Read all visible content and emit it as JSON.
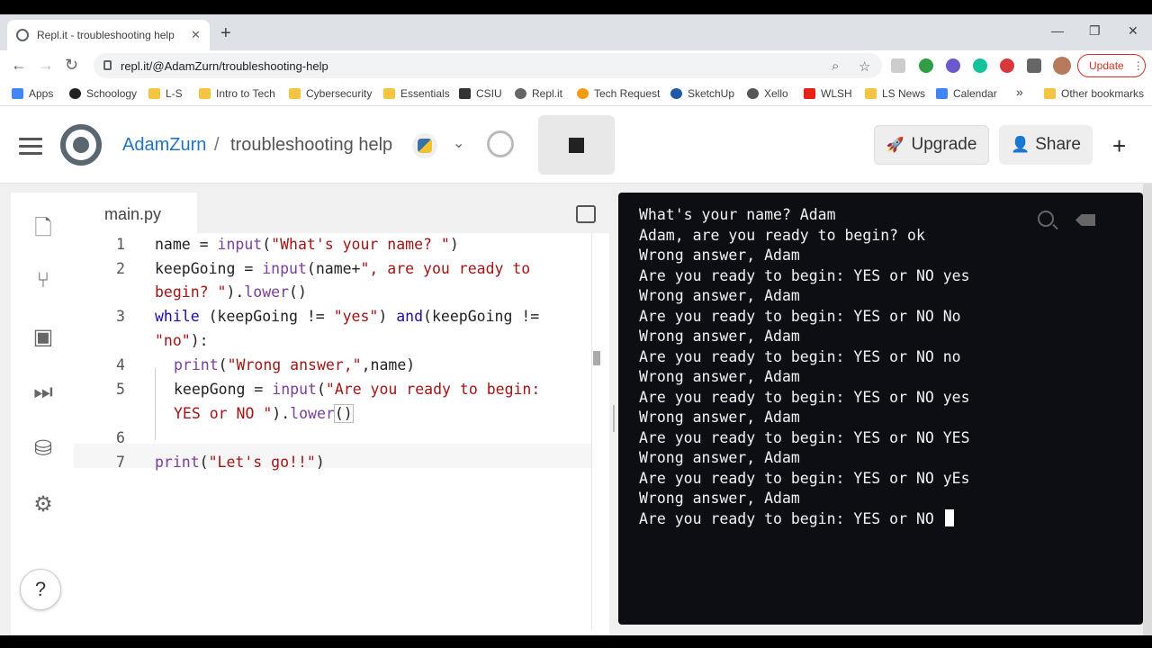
{
  "browser": {
    "tab_title": "Repl.it - troubleshooting help",
    "tab_close": "✕",
    "new_tab": "+",
    "url": "repl.it/@AdamZurn/troubleshooting-help",
    "update_label": "Update",
    "window_controls": [
      "—",
      "❐",
      "✕"
    ]
  },
  "bookmarks": [
    {
      "label": "Apps",
      "icon": "apps-grid-icon"
    },
    {
      "label": "Schoology",
      "icon": "schoology-icon"
    },
    {
      "label": "L-S",
      "icon": "folder-icon"
    },
    {
      "label": "Intro to Tech",
      "icon": "folder-icon"
    },
    {
      "label": "Cybersecurity",
      "icon": "folder-icon"
    },
    {
      "label": "Essentials",
      "icon": "folder-icon"
    },
    {
      "label": "CSIU",
      "icon": "csiu-icon"
    },
    {
      "label": "Repl.it",
      "icon": "replit-icon"
    },
    {
      "label": "Tech Request",
      "icon": "tech-request-icon"
    },
    {
      "label": "SketchUp",
      "icon": "sketchup-icon"
    },
    {
      "label": "Xello",
      "icon": "xello-icon"
    },
    {
      "label": "WLSH",
      "icon": "youtube-icon"
    },
    {
      "label": "LS News",
      "icon": "folder-icon"
    },
    {
      "label": "Calendar",
      "icon": "calendar-icon"
    }
  ],
  "bookmarks_more": "»",
  "other_bookmarks": "Other bookmarks",
  "header": {
    "username": "AdamZurn",
    "separator": "/",
    "project": "troubleshooting help",
    "upgrade_label": "Upgrade",
    "share_label": "Share",
    "plus": "+"
  },
  "editor": {
    "filename": "main.py",
    "line_numbers": [
      "1",
      "2",
      "3",
      "4",
      "5",
      "6",
      "7"
    ]
  },
  "console": {
    "lines": [
      "What's your name? Adam",
      "Adam, are you ready to begin? ok",
      "Wrong answer, Adam",
      "Are you ready to begin: YES or NO yes",
      "Wrong answer, Adam",
      "Are you ready to begin: YES or NO No",
      "Wrong answer, Adam",
      "Are you ready to begin: YES or NO no",
      "Wrong answer, Adam",
      "Are you ready to begin: YES or NO yes",
      "Wrong answer, Adam",
      "Are you ready to begin: YES or NO YES",
      "Wrong answer, Adam",
      "Are you ready to begin: YES or NO yEs",
      "Wrong answer, Adam"
    ],
    "last_line": "Are you ready to begin: YES or NO "
  },
  "help_label": "?"
}
